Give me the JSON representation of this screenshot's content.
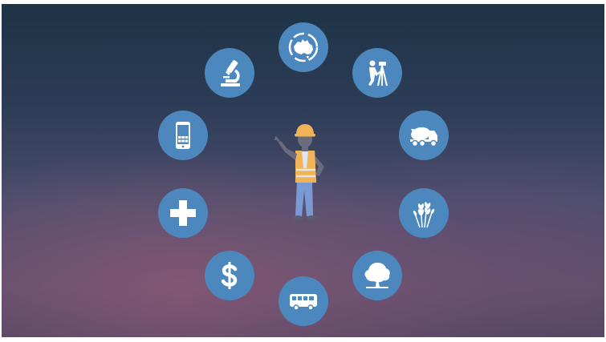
{
  "scene": {
    "background_colors": {
      "top": "#1e3346",
      "bottom": "#5e4e6c"
    },
    "circle_color": "#4c88bd",
    "icon_color": "#ffffff",
    "center_figure": "construction-worker-icon",
    "ring_icons": [
      "australia-map-icon",
      "surveyor-icon",
      "cement-truck-icon",
      "wheat-icon",
      "tree-icon",
      "bus-icon",
      "dollar-icon",
      "medical-cross-icon",
      "smartphone-icon",
      "microscope-icon"
    ]
  }
}
